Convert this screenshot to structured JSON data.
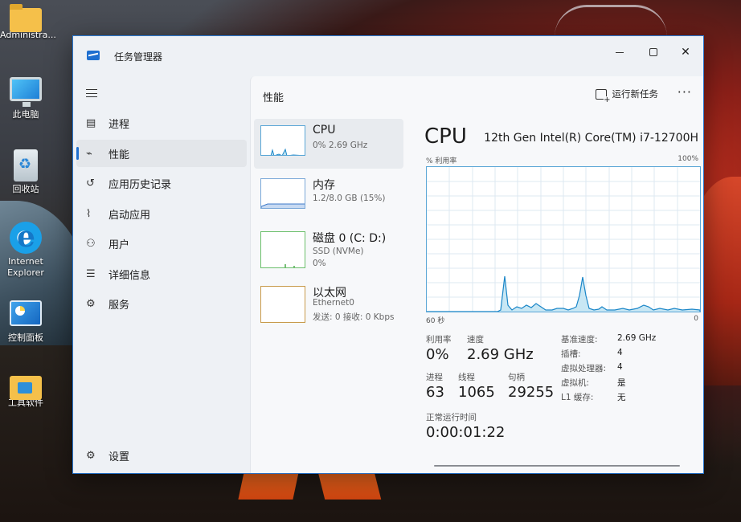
{
  "desktop": {
    "icons": [
      {
        "label": "Administra...",
        "icon": "folder-icon"
      },
      {
        "label": "此电脑",
        "icon": "computer-icon"
      },
      {
        "label": "回收站",
        "icon": "recycle-bin-icon"
      },
      {
        "label": "Internet Explorer",
        "icon": "internet-explorer-icon"
      },
      {
        "label": "控制面板",
        "icon": "control-panel-icon"
      },
      {
        "label": "工具软件",
        "icon": "tools-folder-icon"
      }
    ]
  },
  "window": {
    "title": "任务管理器",
    "accent": "#1e6fd0",
    "controls": {
      "minimize": "minimize-icon",
      "maximize": "maximize-icon",
      "close": "✕"
    }
  },
  "sidebar": {
    "items": [
      {
        "label": "进程",
        "icon": "▤"
      },
      {
        "label": "性能",
        "icon": "⌁",
        "active": true
      },
      {
        "label": "应用历史记录",
        "icon": "↺"
      },
      {
        "label": "启动应用",
        "icon": "⌇"
      },
      {
        "label": "用户",
        "icon": "⚇"
      },
      {
        "label": "详细信息",
        "icon": "☰"
      },
      {
        "label": "服务",
        "icon": "⚙"
      }
    ],
    "settings": {
      "label": "设置",
      "icon": "⚙"
    }
  },
  "header": {
    "title": "性能",
    "run_task": "运行新任务",
    "more": "···"
  },
  "tiles": [
    {
      "name": "CPU",
      "lines": [
        "0% 2.69 GHz"
      ]
    },
    {
      "name": "内存",
      "lines": [
        "1.2/8.0 GB (15%)"
      ]
    },
    {
      "name": "磁盘 0 (C: D:)",
      "lines": [
        "SSD (NVMe)",
        "0%"
      ]
    },
    {
      "name": "以太网",
      "lines": [
        "Ethernet0",
        "发送: 0 接收: 0 Kbps"
      ]
    }
  ],
  "detail": {
    "heading": "CPU",
    "model": "12th Gen Intel(R) Core(TM) i7-12700H",
    "graph": {
      "y_label": "% 利用率",
      "y_max_label": "100%",
      "x_left_label": "60 秒",
      "x_right_label": "0"
    },
    "stats": {
      "utilization": {
        "label": "利用率",
        "value": "0%"
      },
      "speed": {
        "label": "速度",
        "value": "2.69 GHz"
      },
      "processes": {
        "label": "进程",
        "value": "63"
      },
      "threads": {
        "label": "线程",
        "value": "1065"
      },
      "handles": {
        "label": "句柄",
        "value": "29255"
      },
      "uptime": {
        "label": "正常运行时间",
        "value": "0:00:01:22"
      }
    },
    "specs": [
      {
        "k": "基准速度:",
        "v": "2.69 GHz"
      },
      {
        "k": "插槽:",
        "v": "4"
      },
      {
        "k": "虚拟处理器:",
        "v": "4"
      },
      {
        "k": "虚拟机:",
        "v": "是"
      },
      {
        "k": "L1 缓存:",
        "v": "无"
      }
    ]
  }
}
